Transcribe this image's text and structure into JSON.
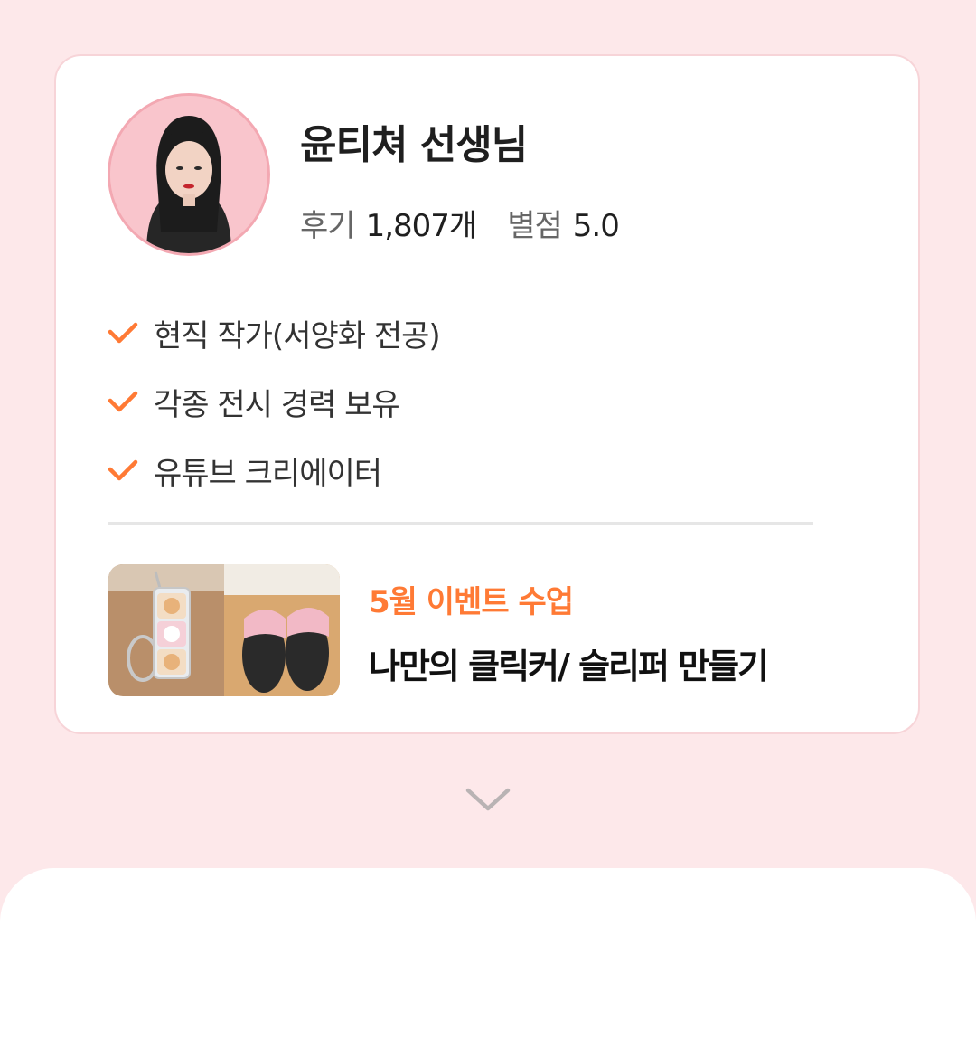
{
  "teacher": {
    "name": "윤티쳐 선생님",
    "review_label": "후기",
    "review_count": "1,807개",
    "rating_label": "별점",
    "rating_value": "5.0"
  },
  "credentials": [
    "현직 작가(서양화 전공)",
    "각종 전시 경력 보유",
    "유튜브 크리에이터"
  ],
  "event": {
    "tag": "5월 이벤트 수업",
    "title": "나만의 클릭커/ 슬리퍼 만들기"
  },
  "colors": {
    "background": "#fde8ea",
    "accent": "#ff7a35",
    "card_border": "#f7d4d8"
  },
  "icons": {
    "check": "check-icon",
    "expand": "chevron-down-icon"
  }
}
